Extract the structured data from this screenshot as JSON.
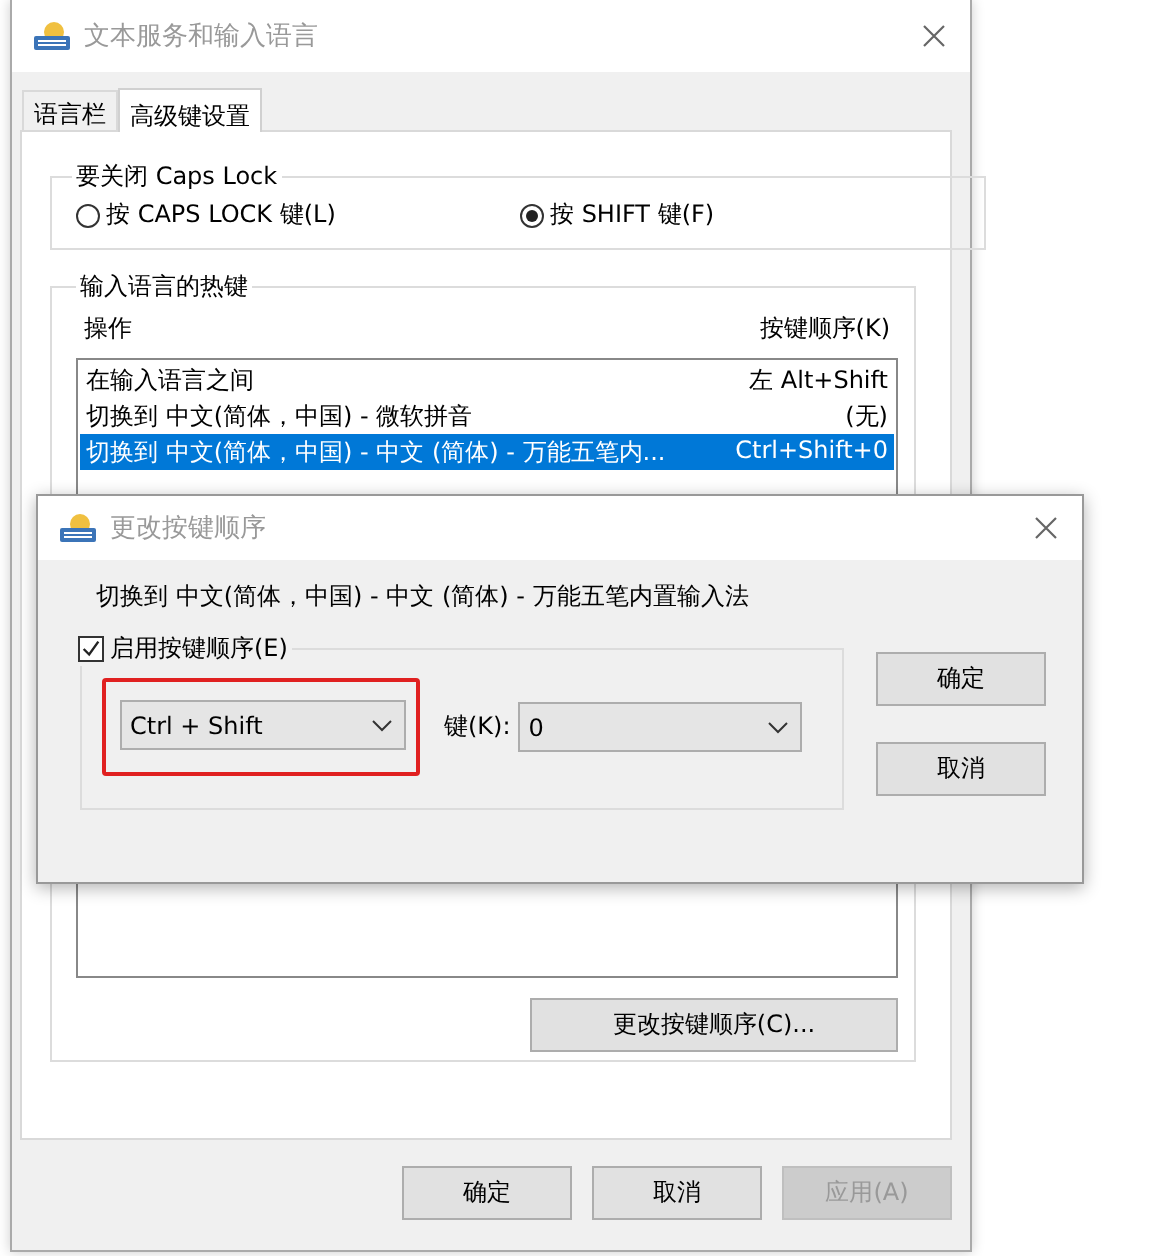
{
  "main_window": {
    "title": "文本服务和输入语言",
    "tabs": [
      {
        "label": "语言栏",
        "selected": false
      },
      {
        "label": "高级键设置",
        "selected": true
      }
    ],
    "caps_lock_group": {
      "title": "要关闭 Caps Lock",
      "options": [
        {
          "label": "按 CAPS LOCK 键(L)",
          "selected": false
        },
        {
          "label": "按 SHIFT 键(F)",
          "selected": true
        }
      ]
    },
    "hotkeys_group": {
      "title": "输入语言的热键",
      "columns": [
        "操作",
        "按键顺序(K)"
      ],
      "rows": [
        {
          "action": "在输入语言之间",
          "key_sequence": "左 Alt+Shift",
          "selected": false
        },
        {
          "action": "切换到 中文(简体，中国) - 微软拼音",
          "key_sequence": "(无)",
          "selected": false
        },
        {
          "action": "切换到 中文(简体，中国) - 中文 (简体) - 万能五笔内...",
          "key_sequence": "Ctrl+Shift+0",
          "selected": true
        }
      ],
      "change_button": "更改按键顺序(C)..."
    },
    "buttons": [
      {
        "label": "确定",
        "disabled": false
      },
      {
        "label": "取消",
        "disabled": false
      },
      {
        "label": "应用(A)",
        "disabled": true
      }
    ]
  },
  "dialog": {
    "title": "更改按键顺序",
    "description": "切换到 中文(简体，中国) - 中文 (简体) - 万能五笔内置输入法",
    "enable": {
      "label": "启用按键顺序(E)",
      "checked": true
    },
    "modifier_select": {
      "value": "Ctrl + Shift",
      "highlighted": true
    },
    "key_label": "键(K):",
    "key_select": {
      "value": "0"
    },
    "buttons": [
      "确定",
      "取消"
    ]
  }
}
